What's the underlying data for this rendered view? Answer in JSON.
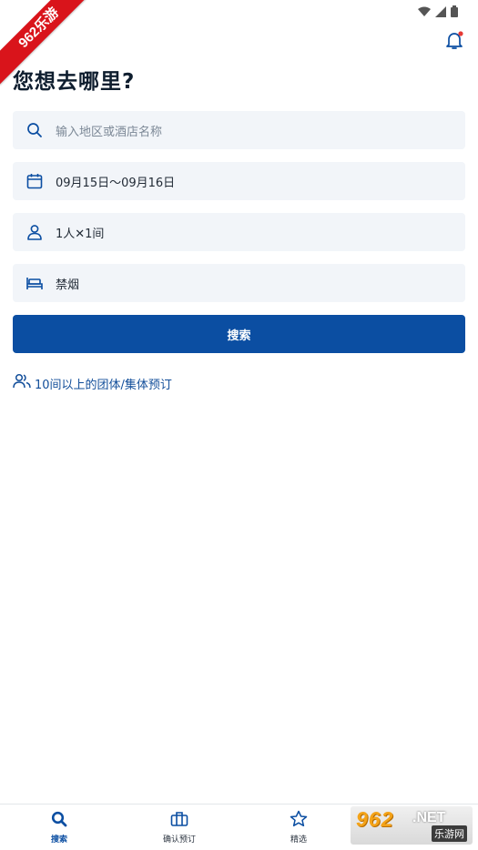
{
  "corner_logo": "962乐游",
  "header": {
    "title": "您想去哪里?"
  },
  "form": {
    "destination_placeholder": "输入地区或酒店名称",
    "dates": "09月15日〜09月16日",
    "guests_rooms": "1人✕1间",
    "smoking": "禁烟",
    "search_button": "搜索"
  },
  "group_booking_link": "10间以上的团体/集体预订",
  "bottom_nav": [
    {
      "label": "搜索",
      "icon": "search-icon",
      "active": true
    },
    {
      "label": "确认预订",
      "icon": "briefcase-icon",
      "active": false
    },
    {
      "label": "精选",
      "icon": "star-icon",
      "active": false
    }
  ],
  "watermark": {
    "brand": "962",
    "suffix": ".NET",
    "sub": "乐游网"
  },
  "colors": {
    "primary": "#0b4ea2",
    "field_bg": "#f2f5f9",
    "notification_dot": "#e53935"
  }
}
